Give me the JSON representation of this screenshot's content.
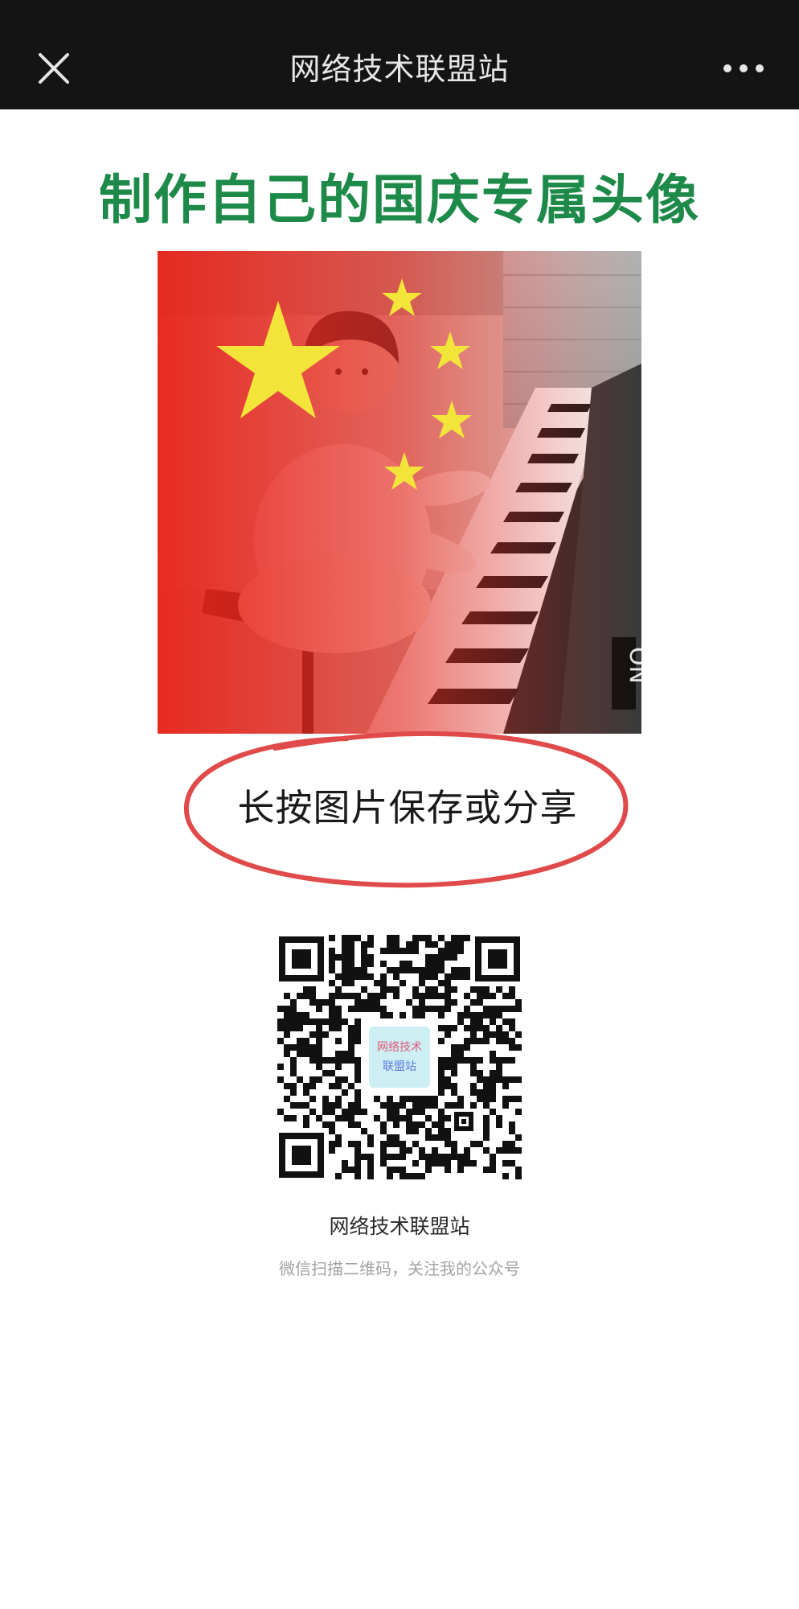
{
  "navbar": {
    "title": "网络技术联盟站",
    "close_icon": "close-icon",
    "more_icon": "more-options-icon"
  },
  "headline": "制作自己的国庆专属头像",
  "avatar": {
    "description_icon": "avatar-photo-with-flag-overlay",
    "overlay_color": "#e8231a",
    "star_color": "#f3e43a"
  },
  "hint": {
    "text": "长按图片保存或分享",
    "circle_color": "#e04a4a"
  },
  "qr": {
    "logo_text_line1": "网络技术",
    "logo_text_line2": "联盟站",
    "name": "网络技术联盟站",
    "tip": "微信扫描二维码，关注我的公众号"
  },
  "colors": {
    "navbar_bg": "#141414",
    "headline": "#1e8a4a"
  }
}
